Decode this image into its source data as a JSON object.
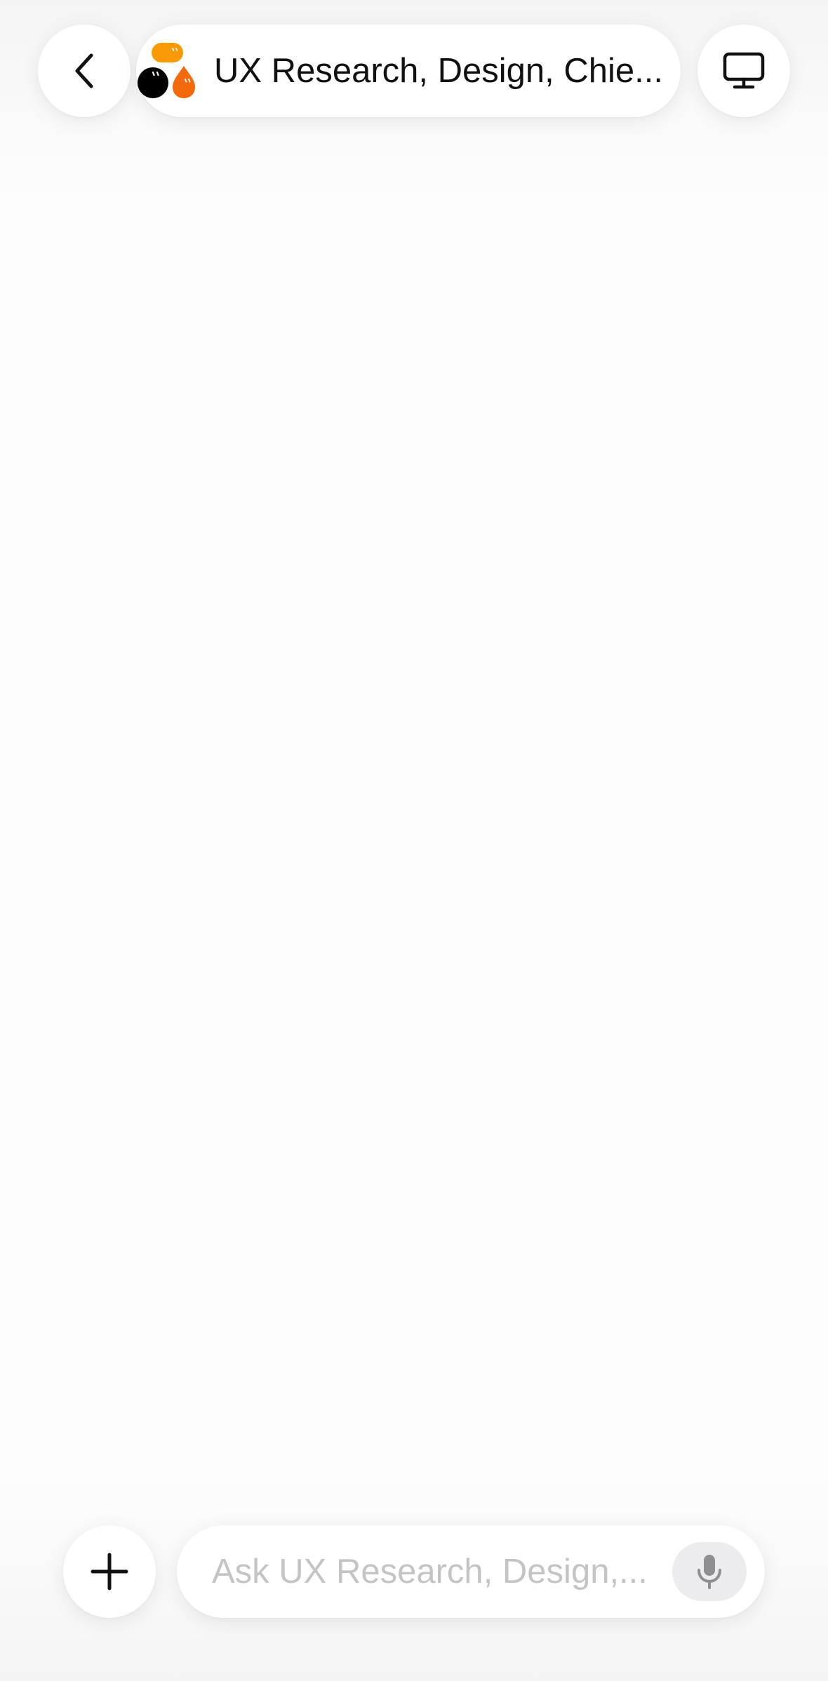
{
  "header": {
    "title": "UX Research, Design, Chie...",
    "back_icon": "chevron-left-icon",
    "desktop_icon": "desktop-monitor-icon"
  },
  "composer": {
    "placeholder": "Ask UX Research, Design,...",
    "value": "",
    "plus_icon": "plus-icon",
    "mic_icon": "microphone-icon"
  },
  "colors": {
    "logo_orange": "#f79a06",
    "logo_red_orange": "#f26a0c",
    "logo_black": "#000000",
    "background": "#fdfdfd",
    "placeholder": "#c4c4c6"
  }
}
